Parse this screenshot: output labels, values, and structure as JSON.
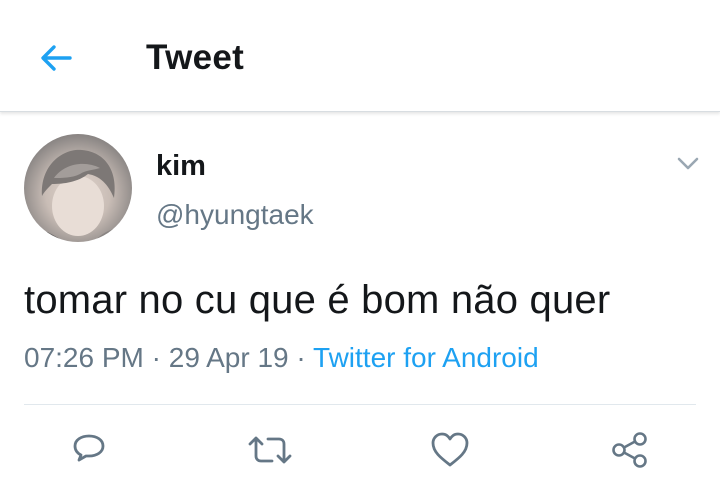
{
  "header": {
    "title": "Tweet",
    "back_icon": "arrow-left-icon"
  },
  "tweet": {
    "author": {
      "display_name": "kim",
      "handle": "@hyungtaek"
    },
    "text": "tomar no cu que é bom não quer",
    "time": "07:26 PM",
    "separator": " · ",
    "date": "29 Apr 19",
    "source": "Twitter for Android"
  },
  "actions": [
    "reply-icon",
    "retweet-icon",
    "like-icon",
    "share-icon"
  ],
  "colors": {
    "accent": "#1da1f2",
    "text": "#14171a",
    "muted": "#657786",
    "icon": "#657786"
  }
}
